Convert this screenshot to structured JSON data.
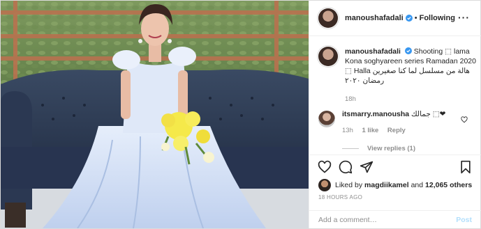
{
  "header": {
    "username": "manoushafadali",
    "separator": "•",
    "follow_state": "Following",
    "more_icon": "ellipsis-icon"
  },
  "caption": {
    "username": "manoushafadali",
    "text": "Shooting ⬚ lama Kona soghyareen series Ramadan 2020 ⬚ Halla هالة من مسلسل لما كنا صغيرين رمضان ٢٠٢٠",
    "time": "18h"
  },
  "comment": {
    "username": "itsmarry.manousha",
    "text": "جمالك ⬚❤",
    "time": "13h",
    "likes": "1 like",
    "reply": "Reply",
    "heart_icon": "heart-outline-icon"
  },
  "view_replies": "View replies (1)",
  "actions": {
    "like_icon": "heart-outline-icon",
    "comment_icon": "comment-icon",
    "share_icon": "paper-plane-icon",
    "save_icon": "bookmark-icon"
  },
  "likes": {
    "prefix": "Liked by",
    "user": "magdiikamel",
    "mid": "and",
    "others": "12,065 others"
  },
  "timestamp": "18 HOURS AGO",
  "add_comment": {
    "placeholder": "Add a comment…",
    "post_label": "Post"
  },
  "colors": {
    "verified": "#3897f0",
    "post_disabled": "#b2dffc",
    "muted": "#8e8e8e"
  }
}
